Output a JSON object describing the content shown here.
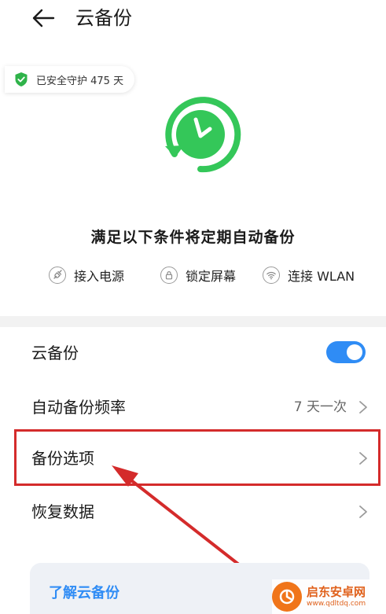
{
  "header": {
    "title": "云备份",
    "back_icon": "arrow-left-icon"
  },
  "badge": {
    "text": "已安全守护 475 天",
    "icon": "shield-check-icon",
    "color": "#2fb34a"
  },
  "illustration": {
    "icon": "clock-refresh-icon",
    "color": "#34c759"
  },
  "conditions": {
    "title": "满足以下条件将定期自动备份",
    "items": [
      {
        "label": "接入电源",
        "icon": "plug-icon"
      },
      {
        "label": "锁定屏幕",
        "icon": "lock-icon"
      },
      {
        "label": "连接 WLAN",
        "icon": "wifi-icon"
      }
    ]
  },
  "settings": {
    "cloud_backup": {
      "label": "云备份",
      "enabled": true
    },
    "frequency": {
      "label": "自动备份频率",
      "value": "7 天一次"
    },
    "backup_options": {
      "label": "备份选项"
    },
    "restore_data": {
      "label": "恢复数据"
    }
  },
  "learn": {
    "title": "了解云备份"
  },
  "watermark": {
    "name": "启东安卓网",
    "url": "www.qdltdq.com"
  },
  "colors": {
    "accent": "#2f8cf5",
    "annotation": "#d42b2b",
    "green": "#34c759"
  }
}
